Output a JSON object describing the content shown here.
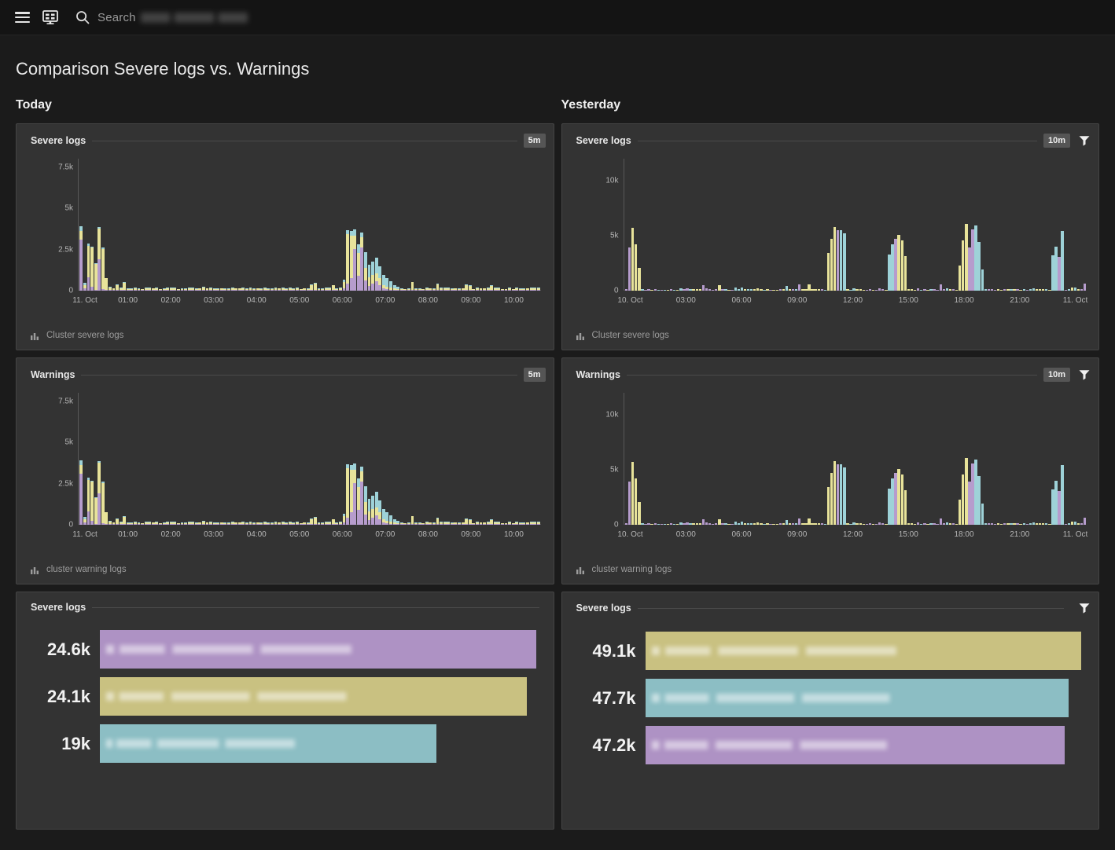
{
  "topbar": {
    "menu_icon": "hamburger-icon",
    "dashboard_icon": "dashboard-icon",
    "search_icon": "search-icon",
    "search_label": "Search",
    "search_value": ""
  },
  "page": {
    "title": "Comparison Severe logs vs. Warnings"
  },
  "columns": [
    {
      "id": "today",
      "title": "Today"
    },
    {
      "id": "yesterday",
      "title": "Yesterday"
    }
  ],
  "colors": {
    "purple": "#b69ccd",
    "yellow": "#e8e39a",
    "cyan": "#9ed2d8",
    "bar_purple": "#ae92c4",
    "bar_khaki": "#c9c181",
    "bar_cyan": "#8cbec4",
    "panel_bg": "#333333",
    "page_bg": "#1b1b1b"
  },
  "panels": {
    "today_severe": {
      "title": "Severe logs",
      "badge": "5m",
      "has_filter": false,
      "footer_label": "Cluster severe logs",
      "footer_icon": "bar-chart-icon"
    },
    "today_warnings": {
      "title": "Warnings",
      "badge": "5m",
      "has_filter": false,
      "footer_label": "cluster warning logs",
      "footer_icon": "bar-chart-icon"
    },
    "yesterday_severe": {
      "title": "Severe logs",
      "badge": "10m",
      "has_filter": true,
      "footer_label": "Cluster severe logs",
      "footer_icon": "bar-chart-icon"
    },
    "yesterday_warnings": {
      "title": "Warnings",
      "badge": "10m",
      "has_filter": true,
      "footer_label": "cluster warning logs",
      "footer_icon": "bar-chart-icon"
    },
    "today_top": {
      "title": "Severe logs",
      "has_filter": false
    },
    "yesterday_top": {
      "title": "Severe logs",
      "has_filter": true
    }
  },
  "chart_data": [
    {
      "id": "today_severe",
      "type": "bar",
      "title": "Severe logs",
      "subtitle": "Today",
      "interval": "5m",
      "stacked": true,
      "ylabel": "",
      "xlabel": "",
      "ylim": [
        0,
        8000
      ],
      "yticks": [
        0,
        2500,
        5000,
        7500
      ],
      "ytick_labels": [
        "0",
        "2.5k",
        "5k",
        "7.5k"
      ],
      "xticks": [
        "11. Oct",
        "01:00",
        "02:00",
        "03:00",
        "04:00",
        "05:00",
        "06:00",
        "07:00",
        "08:00",
        "09:00",
        "10:00"
      ],
      "series": [
        {
          "name": "cyan",
          "color": "#9ed2d8"
        },
        {
          "name": "yellow",
          "color": "#e8e39a"
        },
        {
          "name": "purple",
          "color": "#b69ccd"
        }
      ],
      "values": [
        [
          300,
          500,
          3100
        ],
        [
          80,
          120,
          200
        ],
        [
          150,
          1900,
          150
        ],
        [
          60,
          2350,
          250
        ],
        [
          30,
          1550,
          30
        ],
        [
          40,
          1880,
          1900
        ],
        [
          60,
          2450,
          60
        ],
        [
          20,
          650,
          20
        ],
        [
          10,
          120,
          10
        ],
        [
          5,
          60,
          5
        ],
        [
          8,
          70,
          8
        ],
        [
          6,
          65,
          6
        ],
        [
          5,
          55,
          5
        ],
        [
          5,
          50,
          5
        ],
        [
          6,
          60,
          6
        ],
        [
          5,
          55,
          5
        ],
        [
          5,
          50,
          5
        ],
        [
          4,
          45,
          4
        ],
        [
          5,
          55,
          5
        ],
        [
          4,
          50,
          4
        ],
        [
          4,
          45,
          4
        ],
        [
          5,
          50,
          5
        ],
        [
          4,
          45,
          4
        ],
        [
          5,
          55,
          5
        ],
        [
          6,
          60,
          6
        ],
        [
          5,
          50,
          5
        ],
        [
          4,
          45,
          4
        ],
        [
          5,
          50,
          5
        ],
        [
          6,
          60,
          6
        ],
        [
          4,
          45,
          4
        ],
        [
          5,
          50,
          5
        ],
        [
          4,
          45,
          4
        ],
        [
          5,
          50,
          5
        ],
        [
          6,
          55,
          6
        ],
        [
          5,
          50,
          5
        ],
        [
          4,
          45,
          4
        ],
        [
          10,
          120,
          10
        ],
        [
          20,
          220,
          20
        ],
        [
          25,
          260,
          25
        ],
        [
          18,
          180,
          18
        ],
        [
          10,
          120,
          10
        ],
        [
          6,
          60,
          6
        ],
        [
          5,
          50,
          5
        ],
        [
          4,
          45,
          4
        ],
        [
          5,
          50,
          5
        ],
        [
          5,
          55,
          5
        ],
        [
          4,
          45,
          4
        ],
        [
          5,
          50,
          5
        ],
        [
          6,
          60,
          6
        ],
        [
          5,
          50,
          5
        ],
        [
          4,
          45,
          4
        ],
        [
          5,
          55,
          5
        ],
        [
          6,
          60,
          6
        ],
        [
          5,
          50,
          5
        ],
        [
          4,
          45,
          4
        ],
        [
          5,
          50,
          5
        ],
        [
          6,
          60,
          6
        ],
        [
          5,
          50,
          5
        ],
        [
          4,
          45,
          4
        ],
        [
          30,
          300,
          30
        ],
        [
          6,
          60,
          6
        ],
        [
          5,
          50,
          5
        ],
        [
          4,
          45,
          4
        ],
        [
          5,
          50,
          5
        ],
        [
          6,
          60,
          6
        ],
        [
          5,
          50,
          5
        ],
        [
          10,
          150,
          10
        ],
        [
          20,
          210,
          20
        ],
        [
          14,
          150,
          14
        ],
        [
          10,
          110,
          10
        ],
        [
          8,
          90,
          8
        ],
        [
          120,
          350,
          120
        ],
        [
          300,
          3050,
          400
        ],
        [
          350,
          2500,
          700
        ],
        [
          400,
          800,
          2400
        ],
        [
          500,
          1300,
          900
        ],
        [
          300,
          600,
          2500
        ],
        [
          900,
          700,
          600
        ],
        [
          700,
          500,
          300
        ],
        [
          800,
          500,
          400
        ],
        [
          900,
          450,
          550
        ],
        [
          700,
          400,
          300
        ],
        [
          600,
          200,
          100
        ],
        [
          20,
          120,
          20
        ],
        [
          10,
          90,
          10
        ],
        [
          8,
          70,
          8
        ],
        [
          6,
          60,
          6
        ],
        [
          5,
          50,
          5
        ],
        [
          6,
          60,
          6
        ],
        [
          5,
          50,
          5
        ],
        [
          8,
          80,
          8
        ],
        [
          6,
          60,
          6
        ],
        [
          12,
          160,
          12
        ],
        [
          8,
          90,
          8
        ],
        [
          6,
          60,
          6
        ],
        [
          10,
          110,
          10
        ],
        [
          8,
          80,
          8
        ],
        [
          14,
          170,
          14
        ],
        [
          8,
          80,
          8
        ],
        [
          6,
          60,
          6
        ],
        [
          5,
          50,
          5
        ],
        [
          6,
          60,
          6
        ],
        [
          5,
          50,
          5
        ],
        [
          8,
          80,
          8
        ],
        [
          6,
          60,
          6
        ],
        [
          12,
          150,
          12
        ],
        [
          6,
          60,
          6
        ],
        [
          5,
          50,
          5
        ],
        [
          4,
          45,
          4
        ],
        [
          5,
          50,
          5
        ]
      ]
    },
    {
      "id": "today_warnings",
      "type": "bar",
      "title": "Warnings",
      "subtitle": "Today",
      "interval": "5m",
      "stacked": true,
      "ylim": [
        0,
        8000
      ],
      "yticks": [
        0,
        2500,
        5000,
        7500
      ],
      "ytick_labels": [
        "0",
        "2.5k",
        "5k",
        "7.5k"
      ],
      "xticks": [
        "11. Oct",
        "01:00",
        "02:00",
        "03:00",
        "04:00",
        "05:00",
        "06:00",
        "07:00",
        "08:00",
        "09:00",
        "10:00"
      ],
      "series": [
        {
          "name": "cyan",
          "color": "#9ed2d8"
        },
        {
          "name": "yellow",
          "color": "#e8e39a"
        },
        {
          "name": "purple",
          "color": "#b69ccd"
        }
      ]
    },
    {
      "id": "yesterday_severe",
      "type": "bar",
      "title": "Severe logs",
      "subtitle": "Yesterday",
      "interval": "10m",
      "stacked": false,
      "ylim": [
        0,
        12000
      ],
      "yticks": [
        0,
        5000,
        10000
      ],
      "ytick_labels": [
        "0",
        "5k",
        "10k"
      ],
      "xticks": [
        "10. Oct",
        "03:00",
        "06:00",
        "09:00",
        "12:00",
        "15:00",
        "18:00",
        "21:00",
        "11. Oct"
      ],
      "series": [
        {
          "name": "cyan",
          "color": "#9ed2d8"
        },
        {
          "name": "yellow",
          "color": "#e8e39a"
        },
        {
          "name": "purple",
          "color": "#b69ccd"
        }
      ]
    },
    {
      "id": "yesterday_warnings",
      "type": "bar",
      "title": "Warnings",
      "subtitle": "Yesterday",
      "interval": "10m",
      "stacked": false,
      "ylim": [
        0,
        12000
      ],
      "yticks": [
        0,
        5000,
        10000
      ],
      "ytick_labels": [
        "0",
        "5k",
        "10k"
      ],
      "xticks": [
        "10. Oct",
        "03:00",
        "06:00",
        "09:00",
        "12:00",
        "15:00",
        "18:00",
        "21:00",
        "11. Oct"
      ],
      "series": [
        {
          "name": "cyan",
          "color": "#9ed2d8"
        },
        {
          "name": "yellow",
          "color": "#e8e39a"
        },
        {
          "name": "purple",
          "color": "#b69ccd"
        }
      ]
    },
    {
      "id": "today_top_severe",
      "type": "bar",
      "orientation": "horizontal",
      "title": "Severe logs",
      "subtitle": "Today",
      "categories": [
        "",
        "",
        ""
      ],
      "value_labels": [
        "24.6k",
        "24.1k",
        "19k"
      ],
      "values": [
        24600,
        24100,
        19000
      ],
      "colors": [
        "#ae92c4",
        "#c9c181",
        "#8cbec4"
      ],
      "xlim": [
        0,
        24600
      ]
    },
    {
      "id": "yesterday_top_severe",
      "type": "bar",
      "orientation": "horizontal",
      "title": "Severe logs",
      "subtitle": "Yesterday",
      "categories": [
        "",
        "",
        ""
      ],
      "value_labels": [
        "49.1k",
        "47.7k",
        "47.2k"
      ],
      "values": [
        49100,
        47700,
        47200
      ],
      "colors": [
        "#c9c181",
        "#8cbec4",
        "#ae92c4"
      ],
      "xlim": [
        0,
        49100
      ]
    }
  ]
}
